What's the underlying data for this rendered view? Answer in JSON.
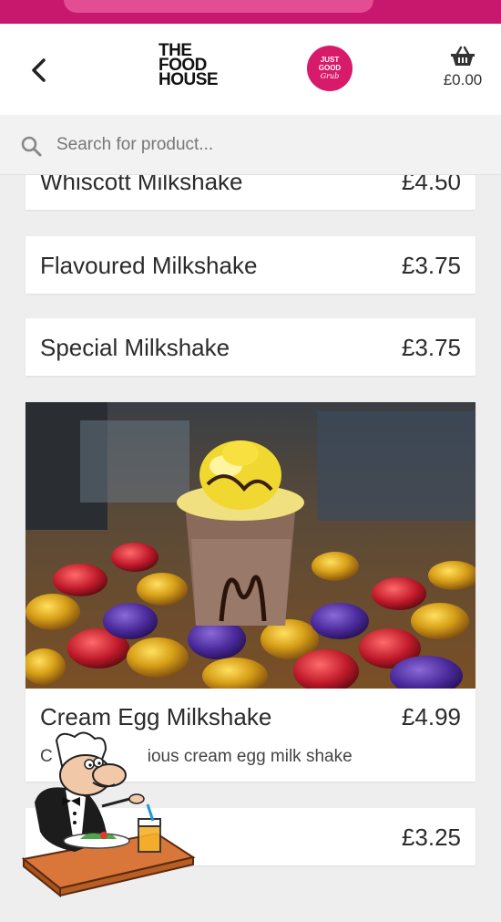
{
  "header": {
    "logo_line1": "THE",
    "logo_line2": "FOOD",
    "logo_line3": "HOUSE",
    "badge_line1": "JUST",
    "badge_line2": "GOOD",
    "badge_script": "Grub",
    "basket_total": "£0.00",
    "back_icon": "chevron-left-icon",
    "basket_icon": "basket-icon"
  },
  "search": {
    "placeholder": "Search for product...",
    "icon": "search-icon"
  },
  "products": [
    {
      "name": "Whiscott Milkshake",
      "price": "£4.50"
    },
    {
      "name": "Flavoured Milkshake",
      "price": "£3.75"
    },
    {
      "name": "Special Milkshake",
      "price": "£3.75"
    },
    {
      "name": "Cream Egg Milkshake",
      "price": "£4.99",
      "description": "ious cream egg milk shake",
      "description_prefix": "C"
    },
    {
      "name": "",
      "price": "£3.25"
    }
  ],
  "colors": {
    "brand": "#c8186e",
    "badge": "#d81a6b"
  }
}
